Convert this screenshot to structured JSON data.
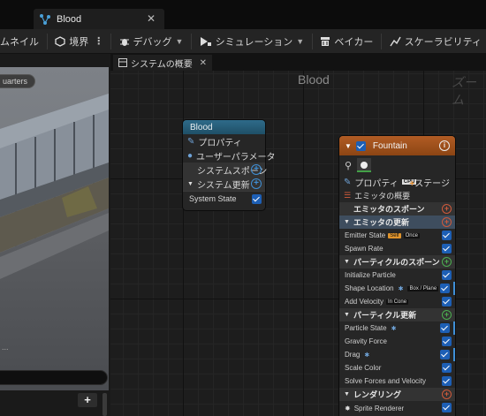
{
  "tab": {
    "label": "Blood"
  },
  "toolbar": {
    "items": [
      {
        "label": "ムネイル"
      },
      {
        "label": "境界"
      },
      {
        "label": "デバッグ"
      },
      {
        "label": "シミュレーション"
      },
      {
        "label": "ベイカー"
      },
      {
        "label": "スケーラビリティ"
      }
    ]
  },
  "viewport": {
    "badge": "uarters",
    "footer_text": "..."
  },
  "graph": {
    "tab_label": "システムの概要",
    "title": "Blood",
    "zoom_label": "ズーム"
  },
  "system_node": {
    "title": "Blood",
    "rows": {
      "properties": "プロパティ",
      "user_params": "ユーザーパラメータ",
      "system_spawn": "システムスポーン",
      "system_update": "システム更新",
      "system_state": "System State"
    }
  },
  "emitter_node": {
    "title": "Fountain",
    "properties_tab": "プロパティ",
    "cpu_badge": "CPU",
    "stage_tab": "ステージ",
    "summary": "エミッタの概要",
    "rows": {
      "emitter_spawn": "エミッタのスポーン",
      "emitter_update": "エミッタの更新",
      "emitter_state": "Emitter State",
      "self_pill": "Self",
      "once_pill": "Once",
      "spawn_rate": "Spawn Rate",
      "particle_spawn": "パーティクルのスポーン",
      "initialize_particle": "Initialize Particle",
      "shape_location": "Shape Location",
      "box_plane": "Box / Plane",
      "add_velocity": "Add Velocity",
      "in_cone": "In Cone",
      "particle_update": "パーティクル更新",
      "particle_state": "Particle State",
      "gravity_force": "Gravity Force",
      "drag": "Drag",
      "scale_color": "Scale Color",
      "solve_forces": "Solve Forces and Velocity",
      "render": "レンダリング",
      "sprite_renderer": "Sprite Renderer"
    }
  }
}
